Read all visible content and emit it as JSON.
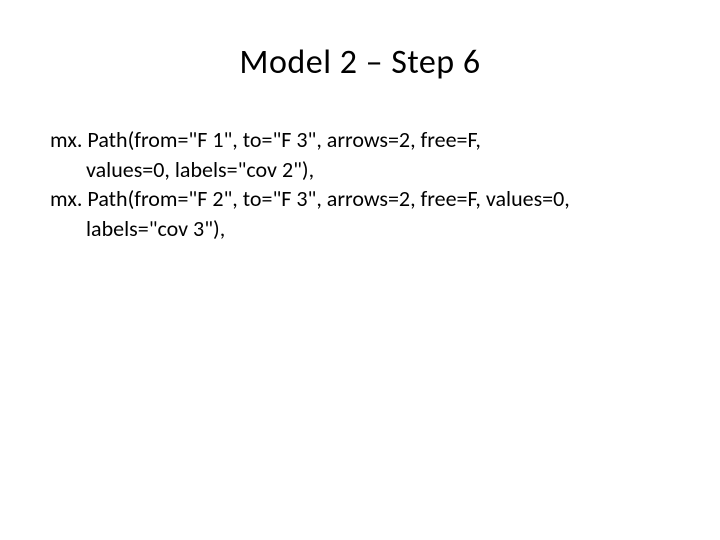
{
  "title": "Model 2 – Step 6",
  "lines": {
    "l1": "mx. Path(from=\"F 1\", to=\"F 3\", arrows=2, free=F,",
    "l2": "values=0, labels=\"cov 2\"),",
    "l3": "mx. Path(from=\"F 2\", to=\"F 3\", arrows=2, free=F, values=0,",
    "l4": "labels=\"cov 3\"),"
  }
}
